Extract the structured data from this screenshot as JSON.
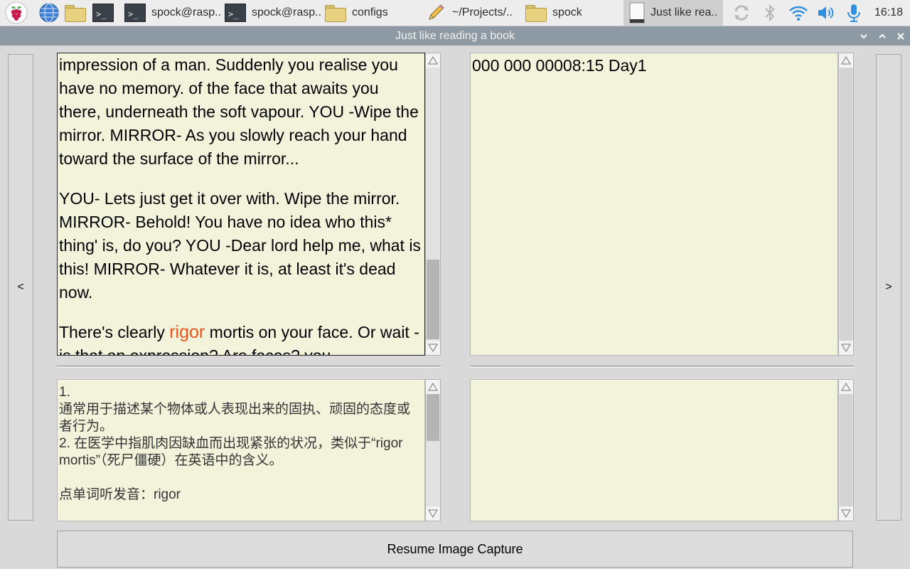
{
  "taskbar": {
    "items": [
      {
        "label": "spock@rasp.."
      },
      {
        "label": "spock@rasp.."
      },
      {
        "label": "configs"
      },
      {
        "label": "~/Projects/.."
      },
      {
        "label": "spock"
      },
      {
        "label": "Just like rea.."
      }
    ],
    "terminal_glyph": ">_",
    "clock": "16:18"
  },
  "window": {
    "title": "Just like reading a book",
    "minimize_glyph": "⌄",
    "maximize_glyph": "⌃",
    "close_glyph": "✕"
  },
  "nav": {
    "prev_label": "<",
    "next_label": ">"
  },
  "book": {
    "p1": "impression of a man. Suddenly you realise you have no memory. of the face that awaits you there, underneath the soft vapour. YOU -Wipe the mirror. MIRROR- As you slowly reach your hand toward the surface of the mirror...",
    "p2": "YOU- Lets just get it over with. Wipe the mirror. MIRROR- Behold! You have no idea who this* thing' is, do you? YOU -Dear lord help me, what is this! MIRROR- Whatever it is, at least it's dead now.",
    "p3_before": "There's clearly ",
    "p3_highlight": "rigor",
    "p3_after": " mortis on your face. Or wait - is that an expression? Are faces? you",
    "highlight_color": "#e8541c"
  },
  "log": {
    "text": "000 000 00008:15 Day1"
  },
  "dictionary": {
    "line1": "1.",
    "line2": "通常用于描述某个物体或人表现出来的固执、顽固的态度或者行为。",
    "line3": "2. 在医学中指肌肉因缺血而出现紧张的状况，类似于“rigor mortis”（死尸僵硬）在英语中的含义。",
    "line4": "点单词听发音：rigor"
  },
  "actions": {
    "resume_label": "Resume Image Capture"
  },
  "colors": {
    "pane_bg": "#f3f3dc",
    "titlebar": "#8d9aa4",
    "taskbar": "#ededed"
  }
}
